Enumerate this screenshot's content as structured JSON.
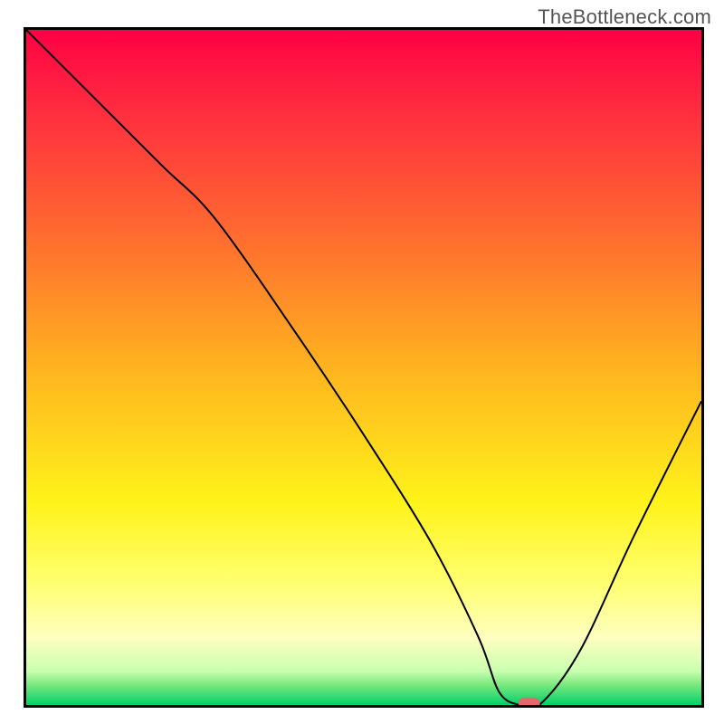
{
  "watermark": "TheBottleneck.com",
  "chart_data": {
    "type": "line",
    "title": "",
    "xlabel": "",
    "ylabel": "",
    "xlim": [
      0,
      100
    ],
    "ylim": [
      0,
      100
    ],
    "grid": false,
    "legend": false,
    "gradient_background": {
      "orientation": "vertical",
      "stops": [
        {
          "offset": 0.0,
          "color": "#ff0044"
        },
        {
          "offset": 0.12,
          "color": "#ff2d3f"
        },
        {
          "offset": 0.3,
          "color": "#ff6a30"
        },
        {
          "offset": 0.5,
          "color": "#ffb31f"
        },
        {
          "offset": 0.7,
          "color": "#fff31a"
        },
        {
          "offset": 0.82,
          "color": "#ffff70"
        },
        {
          "offset": 0.9,
          "color": "#ffffc0"
        },
        {
          "offset": 0.95,
          "color": "#c8ffb0"
        },
        {
          "offset": 0.97,
          "color": "#7be87d"
        },
        {
          "offset": 1.0,
          "color": "#00d26a"
        }
      ]
    },
    "series": [
      {
        "name": "bottleneck-curve",
        "color": "#000000",
        "x": [
          0,
          10,
          20,
          28,
          40,
          50,
          60,
          67,
          70,
          73,
          76,
          82,
          90,
          100
        ],
        "y": [
          100,
          90,
          80,
          72,
          55,
          40,
          24,
          10,
          2,
          0,
          0,
          8,
          25,
          45
        ]
      }
    ],
    "annotations": [
      {
        "type": "marker",
        "name": "target-marker",
        "shape": "rounded-rect",
        "x": 74.5,
        "y": 0,
        "color": "#e46a6a"
      }
    ]
  }
}
